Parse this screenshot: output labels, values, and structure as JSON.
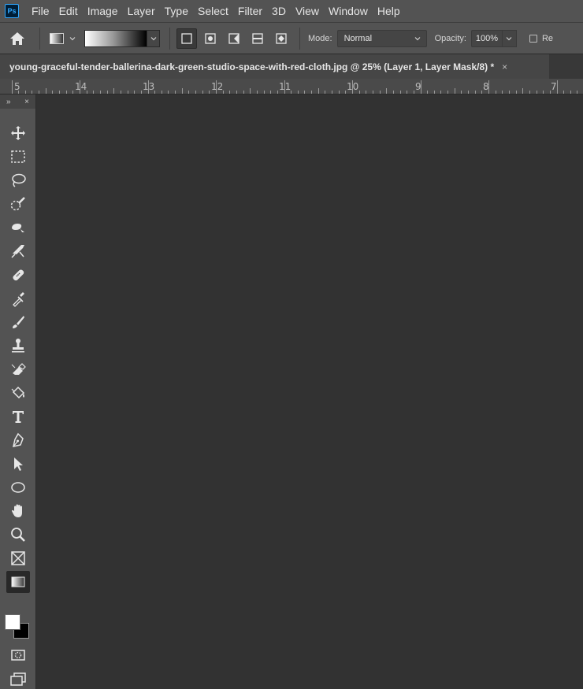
{
  "app": {
    "logo_text": "Ps"
  },
  "menu": [
    "File",
    "Edit",
    "Image",
    "Layer",
    "Type",
    "Select",
    "Filter",
    "3D",
    "View",
    "Window",
    "Help"
  ],
  "options_bar": {
    "mode_label": "Mode:",
    "mode_value": "Normal",
    "opacity_label": "Opacity:",
    "opacity_value": "100%",
    "reverse_label": "Re"
  },
  "document_tab": {
    "title": "young-graceful-tender-ballerina-dark-green-studio-space-with-red-cloth.jpg @ 25% (Layer 1, Layer Mask/8) *",
    "close_glyph": "×"
  },
  "ruler": {
    "labels": [
      "5",
      "14",
      "13",
      "12",
      "11",
      "10",
      "9",
      "8",
      "7"
    ]
  },
  "toolbar": {
    "header_expand": "»",
    "header_close": "×",
    "tools": [
      "move",
      "marquee",
      "lasso",
      "quick-selection",
      "object-selection",
      "crop",
      "healing-brush",
      "eyedropper",
      "brush",
      "clone-stamp",
      "history-brush",
      "paint-bucket",
      "type",
      "pen",
      "path-selection",
      "ellipse",
      "hand",
      "zoom",
      "frame",
      "gradient"
    ],
    "active_tool": "gradient",
    "foreground_color": "#ffffff",
    "background_color": "#000000"
  }
}
